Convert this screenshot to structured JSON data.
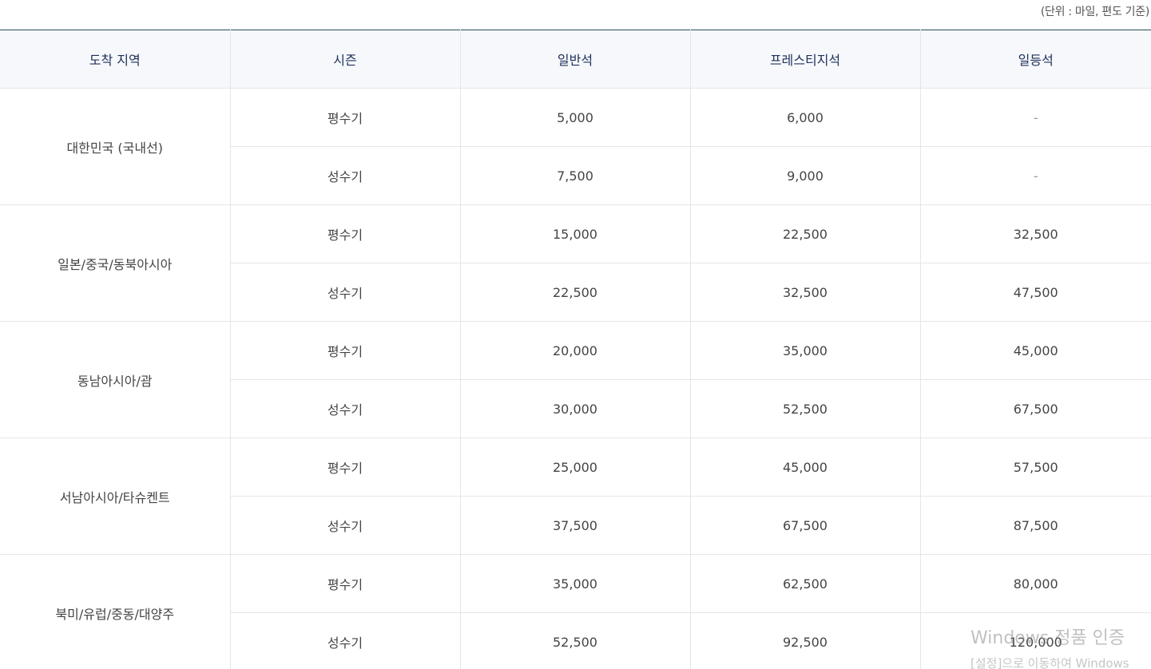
{
  "unit_note": "(단위 : 마일, 편도 기준)",
  "table": {
    "headers": [
      "도착 지역",
      "시즌",
      "일반석",
      "프레스티지석",
      "일등석"
    ],
    "regions": [
      {
        "name": "대한민국 (국내선)",
        "rows": [
          {
            "season": "평수기",
            "economy": "5,000",
            "prestige": "6,000",
            "first": "-"
          },
          {
            "season": "성수기",
            "economy": "7,500",
            "prestige": "9,000",
            "first": "-"
          }
        ]
      },
      {
        "name": "일본/중국/동북아시아",
        "rows": [
          {
            "season": "평수기",
            "economy": "15,000",
            "prestige": "22,500",
            "first": "32,500"
          },
          {
            "season": "성수기",
            "economy": "22,500",
            "prestige": "32,500",
            "first": "47,500"
          }
        ]
      },
      {
        "name": "동남아시아/괌",
        "rows": [
          {
            "season": "평수기",
            "economy": "20,000",
            "prestige": "35,000",
            "first": "45,000"
          },
          {
            "season": "성수기",
            "economy": "30,000",
            "prestige": "52,500",
            "first": "67,500"
          }
        ]
      },
      {
        "name": "서남아시아/타슈켄트",
        "rows": [
          {
            "season": "평수기",
            "economy": "25,000",
            "prestige": "45,000",
            "first": "57,500"
          },
          {
            "season": "성수기",
            "economy": "37,500",
            "prestige": "67,500",
            "first": "87,500"
          }
        ]
      },
      {
        "name": "북미/유럽/중동/대양주",
        "rows": [
          {
            "season": "평수기",
            "economy": "35,000",
            "prestige": "62,500",
            "first": "80,000"
          },
          {
            "season": "성수기",
            "economy": "52,500",
            "prestige": "92,500",
            "first": "120,000"
          }
        ]
      }
    ]
  },
  "watermark": {
    "title": "Windows 정품 인증",
    "subtitle": "[설정]으로 이동하여 Windows"
  },
  "colors": {
    "header_bg": "#f6f8fb",
    "header_text": "#1d2f5a",
    "top_border": "#2c4a5c",
    "cell_border": "#e3e6ea"
  }
}
